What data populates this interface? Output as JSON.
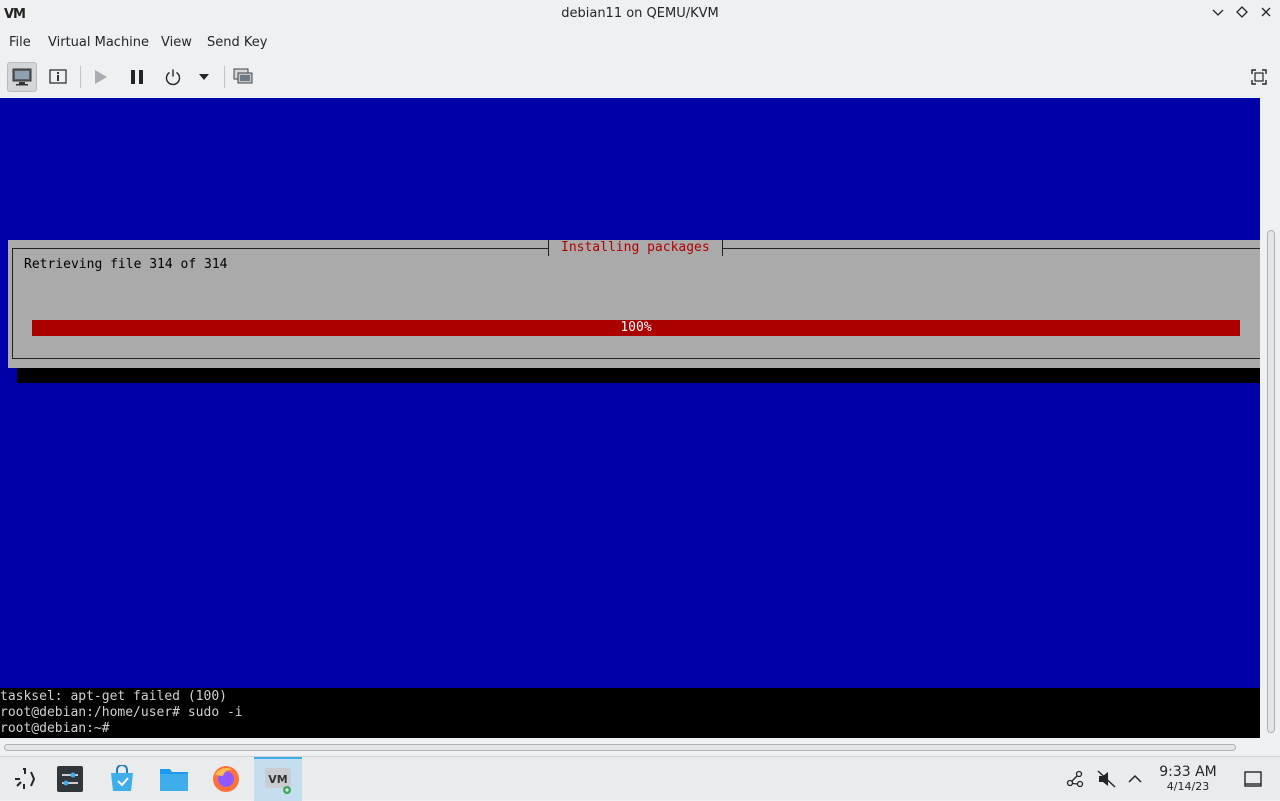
{
  "window": {
    "title": "debian11 on QEMU/KVM",
    "logo_text": "VM"
  },
  "menu": [
    "File",
    "Virtual Machine",
    "View",
    "Send Key"
  ],
  "toolbar": {
    "icons": [
      "console-view-icon",
      "details-view-icon",
      "run-icon",
      "pause-icon",
      "power-icon",
      "power-dropdown-icon",
      "snapshots-icon",
      "fullscreen-icon"
    ]
  },
  "installer": {
    "background_color": "#0000a8",
    "dialog_title": "Installing packages",
    "status_text": "Retrieving file 314 of 314",
    "progress_fraction": 1.0,
    "progress_label": "100%",
    "accent_color": "#aa0000"
  },
  "console": {
    "lines": [
      "tasksel: apt-get failed (100)",
      "root@debian:/home/user# sudo -i",
      "root@debian:~#"
    ]
  },
  "taskbar": {
    "apps": [
      "launcher-icon",
      "system-settings-icon",
      "discover-store-icon",
      "file-manager-icon",
      "firefox-icon",
      "virt-manager-icon"
    ],
    "tray": [
      "network-icon",
      "volume-muted-icon",
      "tray-expand-icon",
      "show-desktop-icon"
    ],
    "clock": {
      "time": "9:33 AM",
      "date": "4/14/23"
    }
  }
}
